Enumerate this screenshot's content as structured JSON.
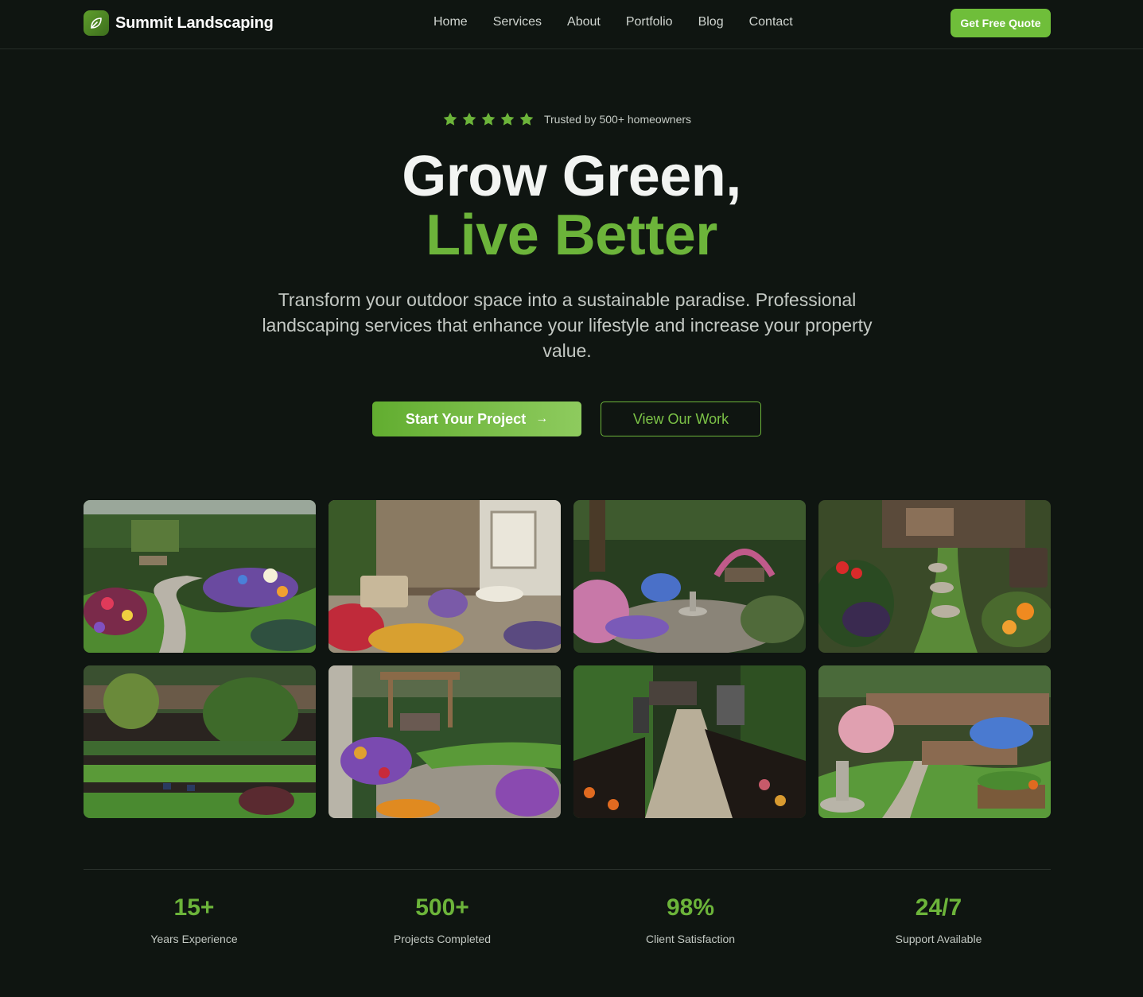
{
  "brand": {
    "name": "Summit Landscaping",
    "logo_icon": "leaf-icon"
  },
  "nav": {
    "links": [
      "Home",
      "Services",
      "About",
      "Portfolio",
      "Blog",
      "Contact"
    ],
    "cta": "Get Free Quote"
  },
  "hero": {
    "rating": 5,
    "trust_text": "Trusted by 500+ homeowners",
    "title_line1": "Grow Green,",
    "title_line2": "Live Better",
    "subtitle": "Transform your outdoor space into a sustainable paradise. Professional landscaping services that enhance your lifestyle and increase your property value.",
    "primary_cta": "Start Your Project",
    "primary_cta_icon": "arrow-right-icon",
    "secondary_cta": "View Our Work"
  },
  "gallery": {
    "count": 8
  },
  "stats": [
    {
      "value": "15+",
      "label": "Years Experience"
    },
    {
      "value": "500+",
      "label": "Projects Completed"
    },
    {
      "value": "98%",
      "label": "Client Satisfaction"
    },
    {
      "value": "24/7",
      "label": "Support Available"
    }
  ],
  "colors": {
    "background": "#0f1511",
    "accent": "#6cb43a",
    "cta": "#6fbe3a",
    "text": "#f2f4f2",
    "muted": "#c4c9c4"
  }
}
